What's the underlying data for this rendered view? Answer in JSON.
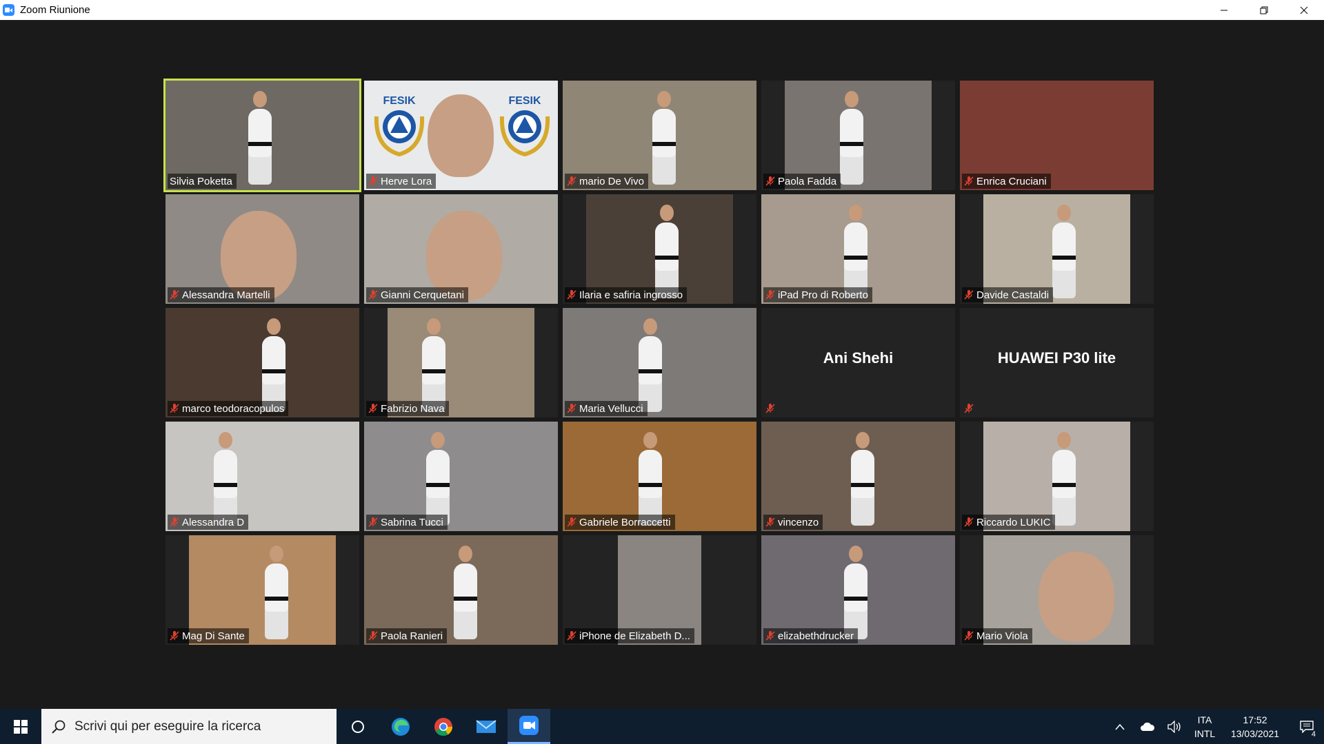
{
  "window": {
    "title": "Zoom Riunione"
  },
  "participants": [
    {
      "name": "Silvia Poketta",
      "muted": false,
      "active": true,
      "bg": "#6e6a63"
    },
    {
      "name": "Herve Lora",
      "muted": true,
      "bg": "#e9eaeb",
      "logo_text": "FESIK"
    },
    {
      "name": "mario De Vivo",
      "muted": true,
      "bg": "#8f8676"
    },
    {
      "name": "Paola Fadda",
      "muted": true,
      "bg": "#7a7470"
    },
    {
      "name": "Enrica Cruciani",
      "muted": true,
      "bg": "#7b3d33"
    },
    {
      "name": "Alessandra Martelli",
      "muted": true,
      "bg": "#8f8a86"
    },
    {
      "name": "Gianni Cerquetani",
      "muted": true,
      "bg": "#b0aba4"
    },
    {
      "name": "Ilaria e safiria ingrosso",
      "muted": true,
      "bg": "#4a4038"
    },
    {
      "name": "iPad Pro di Roberto",
      "muted": true,
      "bg": "#a79a8e"
    },
    {
      "name": "Davide Castaldi",
      "muted": true,
      "bg": "#b9b0a2"
    },
    {
      "name": "marco teodoracopulos",
      "muted": true,
      "bg": "#4a3a30"
    },
    {
      "name": "Fabrizio Nava",
      "muted": true,
      "bg": "#9a8a78"
    },
    {
      "name": "Maria Vellucci",
      "muted": true,
      "bg": "#7d7a77"
    },
    {
      "name": "",
      "muted": true,
      "bg": "#232323",
      "display_text": "Ani Shehi"
    },
    {
      "name": "",
      "muted": true,
      "bg": "#232323",
      "display_text": "HUAWEI P30 lite"
    },
    {
      "name": "Alessandra D",
      "muted": true,
      "bg": "#c7c5c1"
    },
    {
      "name": "Sabrina Tucci",
      "muted": true,
      "bg": "#8f8c8e"
    },
    {
      "name": "Gabriele Borraccetti",
      "muted": true,
      "bg": "#9b6a37"
    },
    {
      "name": "vincenzo",
      "muted": true,
      "bg": "#6e5e52"
    },
    {
      "name": "Riccardo LUKIC",
      "muted": true,
      "bg": "#b8b0a8"
    },
    {
      "name": "Mag Di Sante",
      "muted": true,
      "bg": "#b48a63"
    },
    {
      "name": "Paola Ranieri",
      "muted": true,
      "bg": "#7b6a5a"
    },
    {
      "name": "iPhone de Elizabeth D...",
      "muted": true,
      "bg": "#8a8580"
    },
    {
      "name": "elizabethdrucker",
      "muted": true,
      "bg": "#6e6a70"
    },
    {
      "name": "Mario Viola",
      "muted": true,
      "bg": "#a7a29b"
    }
  ],
  "taskbar": {
    "search_placeholder": "Scrivi qui per eseguire la ricerca",
    "apps": [
      "cortana-icon",
      "edge-icon",
      "chrome-icon",
      "mail-icon",
      "zoom-icon"
    ],
    "lang_line1": "ITA",
    "lang_line2": "INTL",
    "time": "17:52",
    "date": "13/03/2021",
    "notification_count": "4"
  },
  "colors": {
    "active_speaker": "#c6e34a",
    "muted_icon": "#e0412f",
    "taskbar": "#0f1e2e"
  }
}
